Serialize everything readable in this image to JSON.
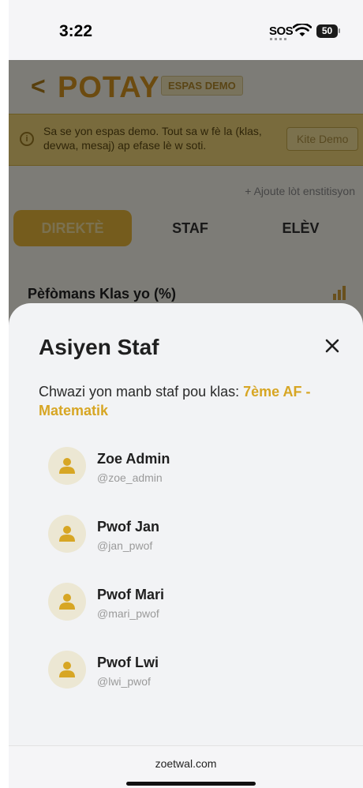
{
  "status_bar": {
    "time": "3:22",
    "sos": "SOS",
    "battery": "50"
  },
  "app": {
    "back_symbol": "<",
    "logo": "POTAY",
    "demo_badge": "ESPAS DEMO",
    "banner": {
      "text": "Sa se yon espas demo. Tout sa w fè la (klas, devwa, mesaj) ap efase lè w soti.",
      "button": "Kite Demo"
    },
    "add_institution": "+ Ajoute lòt enstitisyon",
    "tabs": [
      {
        "label": "DIREKTÈ",
        "active": true
      },
      {
        "label": "STAF",
        "active": false
      },
      {
        "label": "ELÈV",
        "active": false
      }
    ],
    "section_title": "Pèfòmans Klas yo (%)"
  },
  "sheet": {
    "title": "Asiyen Staf",
    "subtitle_prefix": "Chwazi yon manb staf pou klas: ",
    "class_name": "7ème AF - Matematik",
    "staff": [
      {
        "name": "Zoe Admin",
        "username": "@zoe_admin"
      },
      {
        "name": "Pwof Jan",
        "username": "@jan_pwof"
      },
      {
        "name": "Pwof Mari",
        "username": "@mari_pwof"
      },
      {
        "name": "Pwof Lwi",
        "username": "@lwi_pwof"
      }
    ]
  },
  "footer": {
    "domain": "zoetwal.com"
  },
  "colors": {
    "accent": "#d7a624",
    "overlay": "rgba(0,0,0,0.5)",
    "sheet_bg": "#f2f3f5"
  },
  "icons": [
    "wifi-icon",
    "battery-icon",
    "info-icon",
    "plus-circle-icon",
    "bar-chart-icon",
    "close-icon",
    "user-icon"
  ]
}
